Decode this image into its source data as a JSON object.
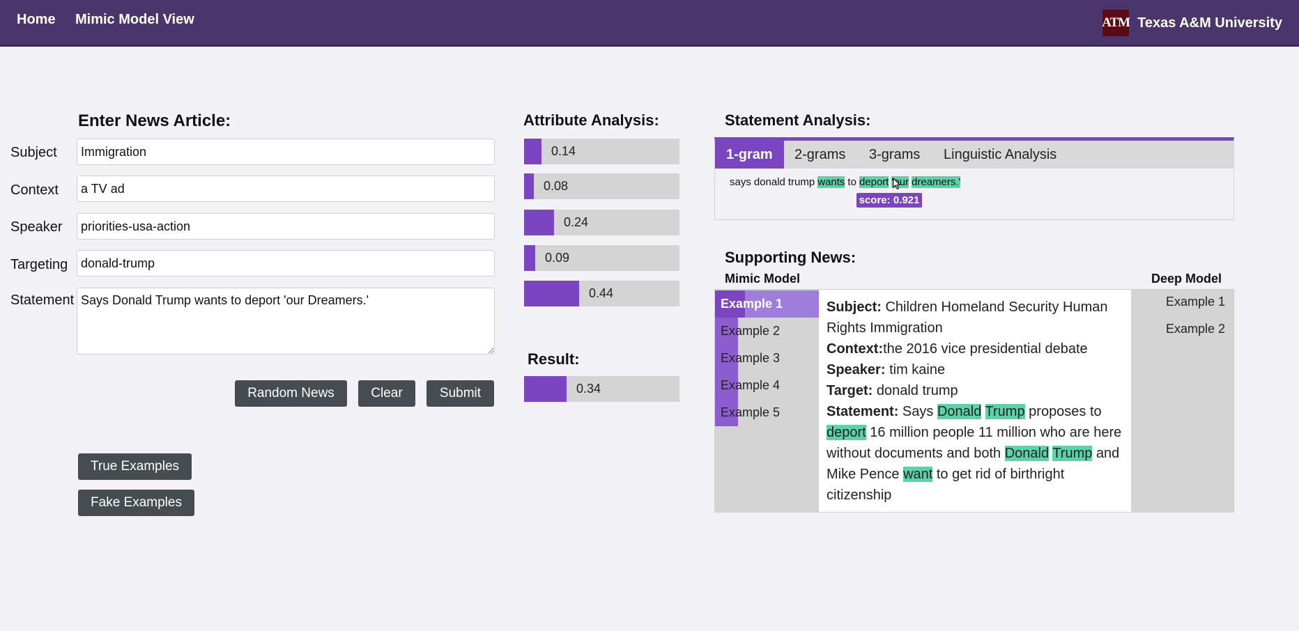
{
  "nav": {
    "home": "Home",
    "mimic_model_view": "Mimic Model View",
    "logo_text": "ATM",
    "university": "Texas A&M University"
  },
  "form": {
    "title": "Enter News Article:",
    "subject_label": "Subject",
    "subject_value": "Immigration",
    "context_label": "Context",
    "context_value": "a TV ad",
    "speaker_label": "Speaker",
    "speaker_value": "priorities-usa-action",
    "targeting_label": "Targeting",
    "targeting_value": "donald-trump",
    "statement_label": "Statement",
    "statement_value": "Says Donald Trump wants to deport 'our Dreamers.'",
    "random_news_button": "Random News",
    "clear_button": "Clear",
    "submit_button": "Submit",
    "true_examples_button": "True Examples",
    "fake_examples_button": "Fake Examples"
  },
  "attribute_analysis": {
    "title": "Attribute Analysis:",
    "bars": [
      {
        "value": 0.14,
        "label": "0.14"
      },
      {
        "value": 0.08,
        "label": "0.08"
      },
      {
        "value": 0.24,
        "label": "0.24"
      },
      {
        "value": 0.09,
        "label": "0.09"
      },
      {
        "value": 0.44,
        "label": "0.44"
      }
    ]
  },
  "result": {
    "title": "Result:",
    "value": 0.34,
    "label": "0.34"
  },
  "statement_analysis": {
    "title": "Statement Analysis:",
    "tabs": [
      "1-gram",
      "2-grams",
      "3-grams",
      "Linguistic Analysis"
    ],
    "active_tab": "1-gram",
    "tokens": [
      {
        "text": "says",
        "highlight": false
      },
      {
        "text": "donald",
        "highlight": false
      },
      {
        "text": "trump",
        "highlight": false
      },
      {
        "text": "wants",
        "highlight": true
      },
      {
        "text": "to",
        "highlight": false
      },
      {
        "text": "deport",
        "highlight": true
      },
      {
        "text": "'our",
        "highlight": true
      },
      {
        "text": "dreamers.'",
        "highlight": true
      }
    ],
    "tooltip": "score: 0.921"
  },
  "supporting_news": {
    "title": "Supporting News:",
    "mimic_model_header": "Mimic Model",
    "deep_model_header": "Deep Model",
    "mimic_examples": [
      {
        "label": "Example 1",
        "strength": 0.29
      },
      {
        "label": "Example 2",
        "strength": 0.22
      },
      {
        "label": "Example 3",
        "strength": 0.22
      },
      {
        "label": "Example 4",
        "strength": 0.22
      },
      {
        "label": "Example 5",
        "strength": 0.22
      }
    ],
    "active_example": "Example 1",
    "deep_examples": [
      "Example 1",
      "Example 2"
    ],
    "detail": {
      "subject_key": "Subject:",
      "subject_value": "Children Homeland Security Human Rights Immigration",
      "context_key": "Context:",
      "context_value": "the 2016 vice presidential debate",
      "speaker_key": "Speaker:",
      "speaker_value": "tim kaine",
      "target_key": "Target:",
      "target_value": "donald trump",
      "statement_key": "Statement:",
      "statement_parts": [
        {
          "text": "Says",
          "highlight": false
        },
        {
          "text": "Donald",
          "highlight": true
        },
        {
          "text": "Trump",
          "highlight": true
        },
        {
          "text": "proposes to",
          "highlight": false
        },
        {
          "text": "deport",
          "highlight": true
        },
        {
          "text": "16 million people 11 million who are here without documents and both",
          "highlight": false
        },
        {
          "text": "Donald",
          "highlight": true
        },
        {
          "text": "Trump",
          "highlight": true
        },
        {
          "text": "and Mike Pence",
          "highlight": false
        },
        {
          "text": "want",
          "highlight": true
        },
        {
          "text": "to get rid of birthright citizenship",
          "highlight": false
        }
      ]
    }
  },
  "colors": {
    "header": "#4a366c",
    "accent": "#7b45c2",
    "highlight": "#5ad3a8",
    "button": "#464c50",
    "logo": "#5c0a16"
  }
}
